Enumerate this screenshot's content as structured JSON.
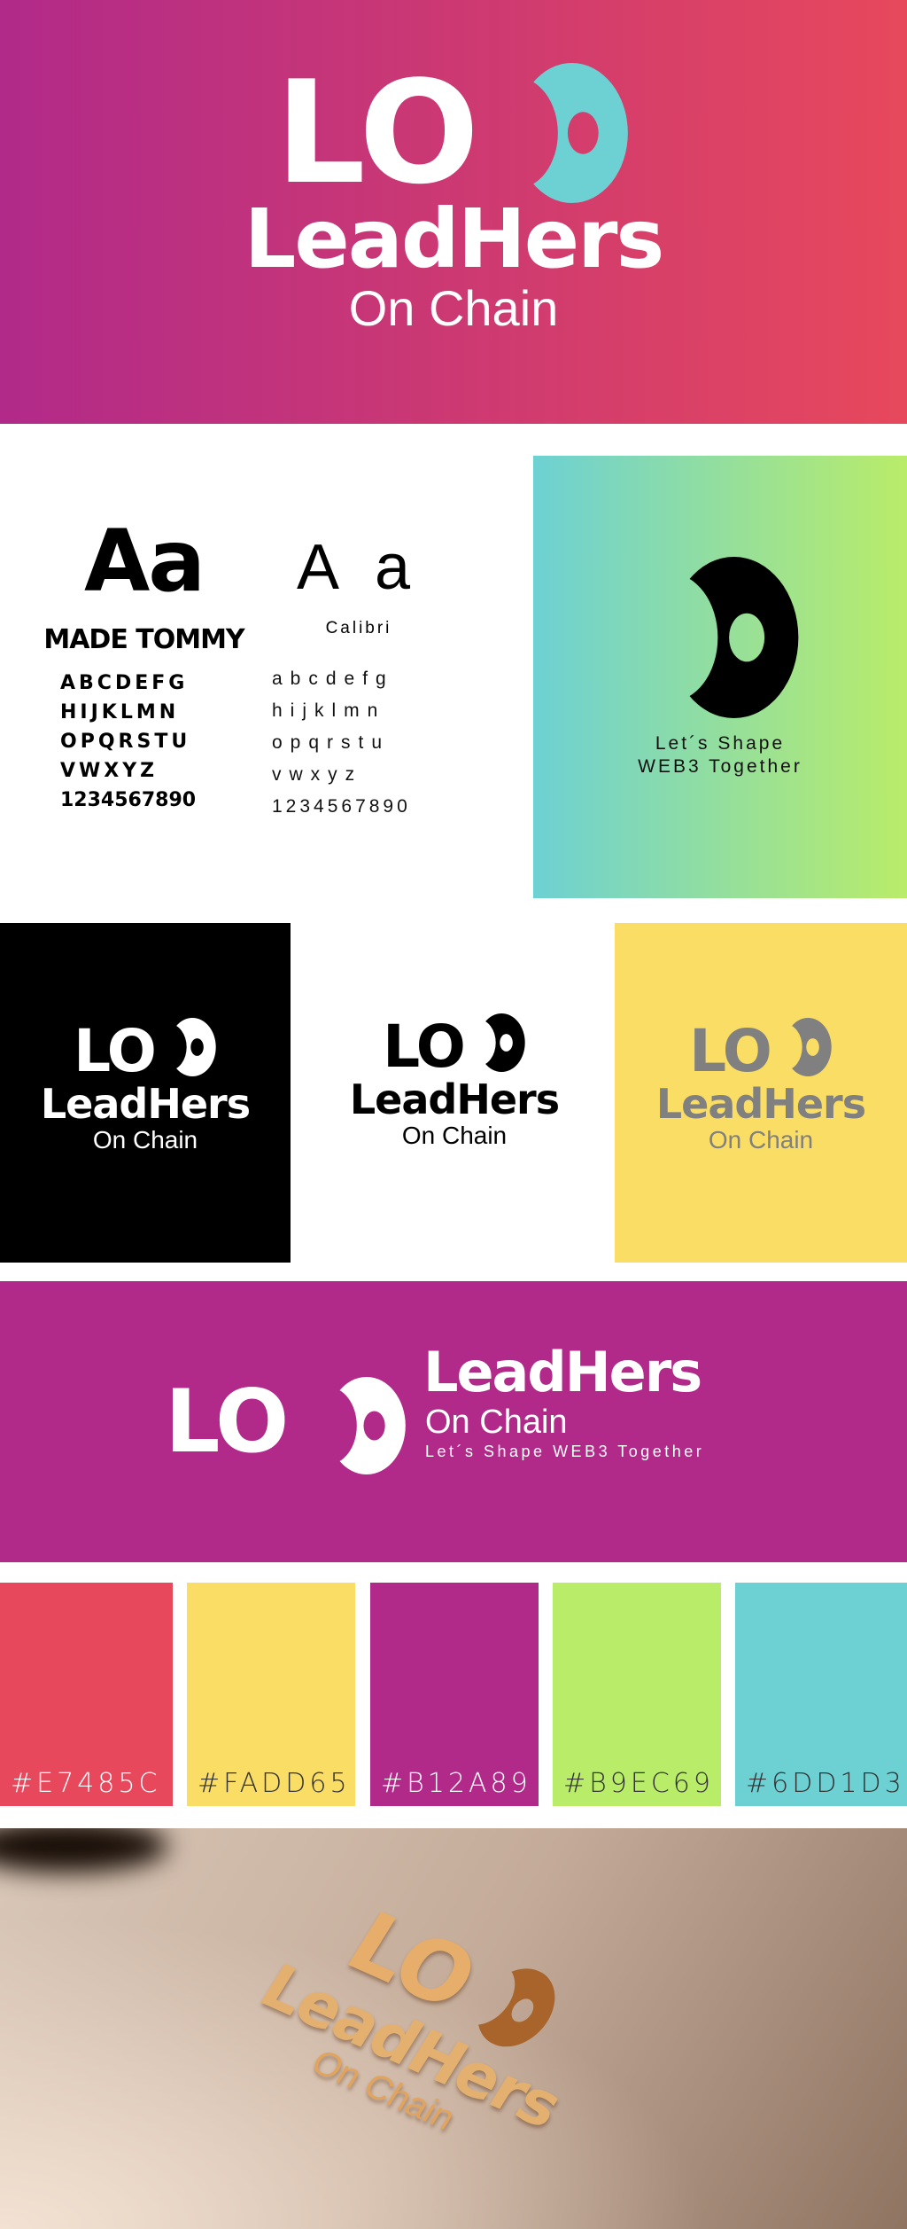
{
  "brand": {
    "lo": "LO",
    "name": "LeadHers",
    "sub": "On Chain",
    "tagline": "Let´s Shape WEB3 Together",
    "tagline_l1": "Let´s Shape",
    "tagline_l2": "WEB3 Together"
  },
  "typography": {
    "primary": {
      "sample": "Aa",
      "name": "MADE TOMMY",
      "rows": [
        "ABCDEFG",
        "HIJKLMN",
        "OPQRSTU",
        "VWXYZ",
        "1234567890"
      ]
    },
    "secondary": {
      "sample": "A a",
      "name": "Calibri",
      "rows": [
        "abcdefg",
        "hijklmn",
        "opqrstu",
        "vwxyz",
        "1234567890"
      ]
    }
  },
  "palette": [
    {
      "hex": "#E7485C",
      "label": "#E7485C",
      "text": "#ffffff"
    },
    {
      "hex": "#FADD65",
      "label": "#FADD65",
      "text": "#333333"
    },
    {
      "hex": "#B12A89",
      "label": "#B12A89",
      "text": "#ffffff"
    },
    {
      "hex": "#B9EC69",
      "label": "#B9EC69",
      "text": "#333333"
    },
    {
      "hex": "#6DD1D3",
      "label": "#6DD1D3",
      "text": "#333333"
    }
  ],
  "colors": {
    "mark_hero": "#6DD1D3",
    "gray": "#808080",
    "black": "#000000",
    "white": "#ffffff",
    "copper": "#d89a55"
  }
}
